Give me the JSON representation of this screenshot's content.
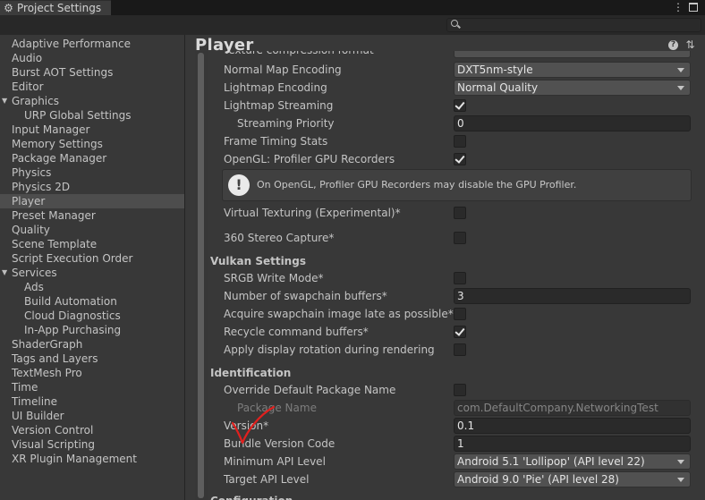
{
  "window": {
    "tab_title": "Project Settings",
    "tab_icon": "gear-icon",
    "menu_glyph": "⋮"
  },
  "search": {
    "placeholder": ""
  },
  "sidebar": {
    "items": [
      {
        "label": "Adaptive Performance"
      },
      {
        "label": "Audio"
      },
      {
        "label": "Burst AOT Settings"
      },
      {
        "label": "Editor"
      },
      {
        "label": "Graphics"
      },
      {
        "label": "URP Global Settings"
      },
      {
        "label": "Input Manager"
      },
      {
        "label": "Memory Settings"
      },
      {
        "label": "Package Manager"
      },
      {
        "label": "Physics"
      },
      {
        "label": "Physics 2D"
      },
      {
        "label": "Player"
      },
      {
        "label": "Preset Manager"
      },
      {
        "label": "Quality"
      },
      {
        "label": "Scene Template"
      },
      {
        "label": "Script Execution Order"
      },
      {
        "label": "Services"
      },
      {
        "label": "Ads"
      },
      {
        "label": "Build Automation"
      },
      {
        "label": "Cloud Diagnostics"
      },
      {
        "label": "In-App Purchasing"
      },
      {
        "label": "ShaderGraph"
      },
      {
        "label": "Tags and Layers"
      },
      {
        "label": "TextMesh Pro"
      },
      {
        "label": "Time"
      },
      {
        "label": "Timeline"
      },
      {
        "label": "UI Builder"
      },
      {
        "label": "Version Control"
      },
      {
        "label": "Visual Scripting"
      },
      {
        "label": "XR Plugin Management"
      }
    ],
    "selected": "Player"
  },
  "main": {
    "title": "Player",
    "partial_top_label": "Texture compression format",
    "rows": {
      "normal_map_encoding": {
        "label": "Normal Map Encoding",
        "value": "DXT5nm-style"
      },
      "lightmap_encoding": {
        "label": "Lightmap Encoding",
        "value": "Normal Quality"
      },
      "lightmap_streaming": {
        "label": "Lightmap Streaming",
        "checked": true
      },
      "streaming_priority": {
        "label": "Streaming Priority",
        "value": "0"
      },
      "frame_timing_stats": {
        "label": "Frame Timing Stats",
        "checked": false
      },
      "opengl_profiler": {
        "label": "OpenGL: Profiler GPU Recorders",
        "checked": true
      },
      "opengl_help": {
        "message": "On OpenGL, Profiler GPU Recorders may disable the GPU Profiler.",
        "icon": "!"
      },
      "virtual_texturing": {
        "label": "Virtual Texturing (Experimental)*",
        "checked": false
      },
      "stereo_capture": {
        "label": "360 Stereo Capture*",
        "checked": false
      }
    },
    "vulkan": {
      "heading": "Vulkan Settings",
      "srgb_write_mode": {
        "label": "SRGB Write Mode*",
        "checked": false
      },
      "swapchain_buffers": {
        "label": "Number of swapchain buffers*",
        "value": "3"
      },
      "acquire_late": {
        "label": "Acquire swapchain image late as possible*",
        "checked": false
      },
      "recycle_buffers": {
        "label": "Recycle command buffers*",
        "checked": true
      },
      "display_rotation": {
        "label": "Apply display rotation during rendering",
        "checked": false
      }
    },
    "identification": {
      "heading": "Identification",
      "override_package": {
        "label": "Override Default Package Name",
        "checked": false
      },
      "package_name": {
        "label": "Package Name",
        "value": "com.DefaultCompany.NetworkingTest"
      },
      "version": {
        "label": "Version*",
        "value": "0.1"
      },
      "bundle_version_code": {
        "label": "Bundle Version Code",
        "value": "1"
      },
      "min_api": {
        "label": "Minimum API Level",
        "value": "Android 5.1 'Lollipop' (API level 22)"
      },
      "target_api": {
        "label": "Target API Level",
        "value": "Android 9.0 'Pie' (API level 28)"
      }
    },
    "partial_bottom_label": "Configuration"
  },
  "colors": {
    "annotation_red": "#e0201e",
    "background": "#383838",
    "selected_row": "#4d4d4d"
  }
}
